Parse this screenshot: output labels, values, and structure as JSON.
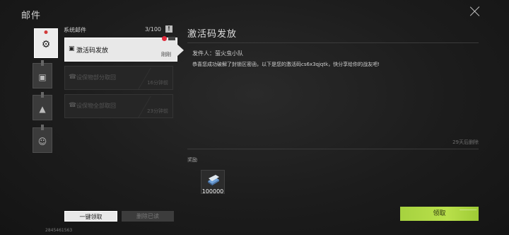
{
  "window": {
    "title": "邮件"
  },
  "categories": [
    {
      "name": "system",
      "icon": "gear-icon",
      "glyph": "⚙"
    },
    {
      "name": "chat",
      "icon": "chat-icon",
      "glyph": "▣"
    },
    {
      "name": "warning",
      "icon": "warning-icon",
      "glyph": "▲"
    },
    {
      "name": "friend",
      "icon": "face-icon",
      "glyph": "☺"
    }
  ],
  "list": {
    "header": "系统邮件",
    "count": "3/100",
    "info_glyph": "!",
    "mails": [
      {
        "subject": "激活码发放",
        "time": "刚刚",
        "icon": "gift-icon",
        "glyph": "▣"
      },
      {
        "subject": "设保物部分取回",
        "time": "16分钟前",
        "icon": "phone-icon",
        "glyph": "☎"
      },
      {
        "subject": "设保物全部取回",
        "time": "23分钟前",
        "icon": "phone-icon",
        "glyph": "☎"
      }
    ],
    "claim_all_label": "一键领取",
    "delete_read_label": "删除已读"
  },
  "uid": "2845461563",
  "detail": {
    "title": "激活码发放",
    "sender_label": "发件人：萤火虫小队",
    "body": "恭喜您成功破解了封锁区密函，以下是您的激活码cs6x3qjqtk，快分享给你的战友吧!",
    "expire_text": "29天后删除",
    "reward_label": "奖励",
    "reward_qty": "100000",
    "claim_label": "领取"
  },
  "colors": {
    "accent": "#b0d944",
    "unread_dot": "#e0293b"
  }
}
